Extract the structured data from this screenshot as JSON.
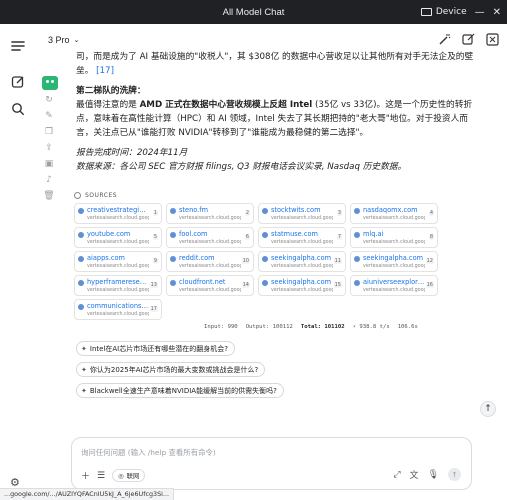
{
  "window": {
    "title": "All Model Chat",
    "device_label": "Device"
  },
  "rail": {
    "icons": [
      "menu-icon",
      "new-chat-icon",
      "search-icon",
      "settings-icon"
    ]
  },
  "header": {
    "model": "3 Pro"
  },
  "message": {
    "intro": "司，而是成为了 AI 基础设施的\"收税人\"，其 $308亿 的数据中心营收足以让其他所有对手无法企及的壁垒。",
    "intro_ref": "[17]",
    "section_title": "第二梯队的洗牌：",
    "body_pre": "最值得注意的是 ",
    "body_bold": "AMD 正式在数据中心营收规模上反超 Intel",
    "body_nums": "(35亿 vs 33亿)",
    "body_rest": "。这是一个历史性的转折点，意味着在高性能计算（HPC）和 AI 领域，Intel 失去了其长期把持的\"老大哥\"地位。对于投资人而言，关注点已从\"谁能打败 NVIDIA\"转移到了\"谁能成为最稳健的第二选择\"。",
    "report_time": "报告完成时间：2024年11月",
    "data_source": "数据来源：各公司 SEC 官方财报 filings, Q3 财报电话会议实录, Nasdaq 历史数据。"
  },
  "sources": {
    "header": "SOURCES",
    "items": [
      {
        "name": "creativestrategies.com",
        "url": "vertexaisearch.cloud.google.com",
        "num": "1"
      },
      {
        "name": "steno.fm",
        "url": "vertexaisearch.cloud.google.com",
        "num": "2"
      },
      {
        "name": "stocktwits.com",
        "url": "vertexaisearch.cloud.google.com",
        "num": "3"
      },
      {
        "name": "nasdaqomx.com",
        "url": "vertexaisearch.cloud.google.com",
        "num": "4"
      },
      {
        "name": "youtube.com",
        "url": "vertexaisearch.cloud.google.com",
        "num": "5"
      },
      {
        "name": "fool.com",
        "url": "vertexaisearch.cloud.google.com",
        "num": "6"
      },
      {
        "name": "statmuse.com",
        "url": "vertexaisearch.cloud.google.com",
        "num": "7"
      },
      {
        "name": "mlq.ai",
        "url": "vertexaisearch.cloud.google.com",
        "num": "8"
      },
      {
        "name": "aiapps.com",
        "url": "vertexaisearch.cloud.google.com",
        "num": "9"
      },
      {
        "name": "reddit.com",
        "url": "vertexaisearch.cloud.google.com",
        "num": "10"
      },
      {
        "name": "seekingalpha.com",
        "url": "vertexaisearch.cloud.google.com",
        "num": "11"
      },
      {
        "name": "seekingalpha.com",
        "url": "vertexaisearch.cloud.google.com",
        "num": "12"
      },
      {
        "name": "hyperframeresearch.com",
        "url": "vertexaisearch.cloud.google.com",
        "num": "13"
      },
      {
        "name": "cloudfront.net",
        "url": "vertexaisearch.cloud.google.com",
        "num": "14"
      },
      {
        "name": "seekingalpha.com",
        "url": "vertexaisearch.cloud.google.com",
        "num": "15"
      },
      {
        "name": "aiuniverseexplorer.com",
        "url": "vertexaisearch.cloud.google.com",
        "num": "16"
      },
      {
        "name": "communicationstoday.co.in",
        "url": "vertexaisearch.cloud.google.com",
        "num": "17"
      }
    ]
  },
  "tokens": {
    "input": "Input: 990",
    "output": "Output: 100112",
    "total": "Total: 101102",
    "speed": "938.8 t/s",
    "time": "106.6s"
  },
  "suggestions": [
    "Intel在AI芯片市场还有哪些潜在的翻身机会?",
    "你认为2025年AI芯片市场的最大变数或挑战会是什么?",
    "Blackwell全速生产意味着NVIDIA能缓解当前的供需失衡吗?"
  ],
  "composer": {
    "placeholder": "询问任何问题 (输入 /help 查看所有命令)",
    "web_label": "联网"
  },
  "status_url": "...google.com/.../AUZIYQFACnlU5kJ_A_6je6Ufcg3Si..."
}
